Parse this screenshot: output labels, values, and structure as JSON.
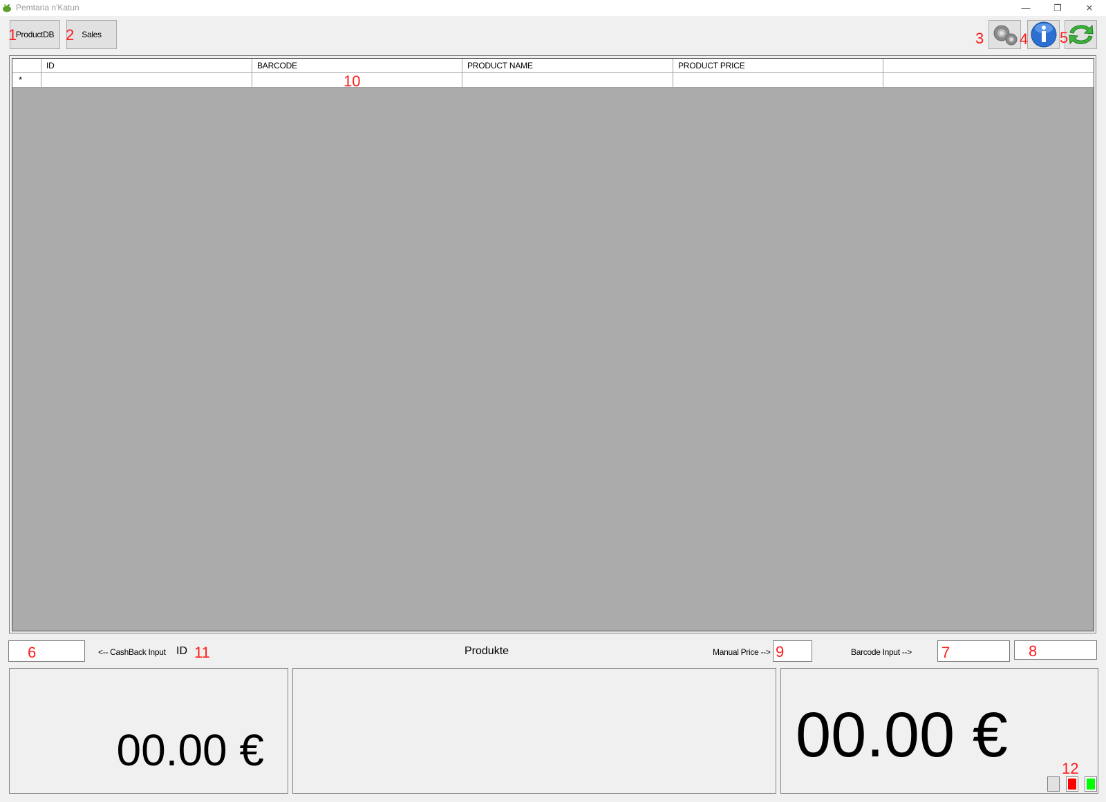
{
  "window": {
    "title": "Pemtaria n'Katun",
    "controls": {
      "minimize": "—",
      "restore": "❐",
      "close": "✕"
    }
  },
  "toolbar": {
    "productdb_label": "ProductDB",
    "sales_label": "Sales",
    "settings_icon": "gears-icon",
    "info_icon": "info-icon",
    "refresh_icon": "refresh-arrows-icon"
  },
  "grid": {
    "columns": [
      "ID",
      "BARCODE",
      "PRODUCT NAME",
      "PRODUCT PRICE",
      ""
    ],
    "new_row_marker": "*",
    "rows": [
      [
        "",
        "",
        "",
        "",
        ""
      ]
    ]
  },
  "inputs": {
    "cashback_value": "",
    "manual_price_value": "",
    "barcode_value": "",
    "barcode_extra_value": ""
  },
  "labels": {
    "cashback_input": "<-- CashBack Input",
    "id": "ID",
    "products": "Produkte",
    "manual_price": "Manual Price -->",
    "barcode_input": "Barcode Input -->"
  },
  "totals": {
    "left_amount": "00.00 €",
    "right_amount": "00.00 €"
  },
  "indicators": {
    "neutral_color": "#e1e1e1",
    "red_color": "#ff0000",
    "green_color": "#00ff00"
  },
  "annotations": [
    "1",
    "2",
    "3",
    "4",
    "5",
    "6",
    "7",
    "8",
    "9",
    "10",
    "11",
    "12"
  ]
}
